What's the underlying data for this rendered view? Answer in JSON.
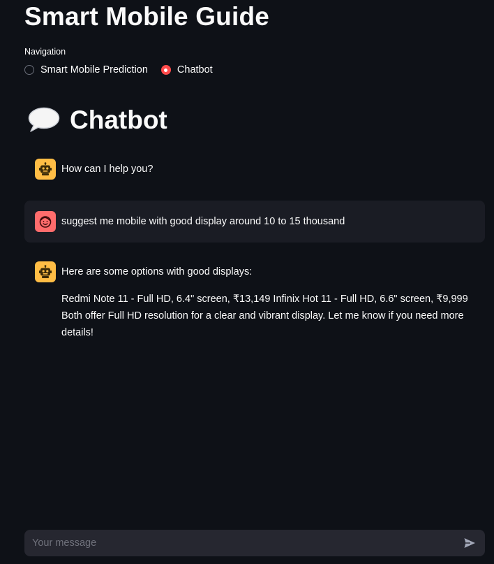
{
  "page": {
    "title": "Smart Mobile Guide"
  },
  "navigation": {
    "label": "Navigation",
    "options": [
      {
        "label": "Smart Mobile Prediction",
        "selected": false
      },
      {
        "label": "Chatbot",
        "selected": true
      }
    ]
  },
  "chat": {
    "header_icon": "speech-bubble-icon",
    "title": "Chatbot",
    "messages": [
      {
        "role": "assistant",
        "avatar_icon": "robot-icon",
        "paragraphs": [
          "How can I help you?"
        ]
      },
      {
        "role": "user",
        "avatar_icon": "smiley-face-icon",
        "paragraphs": [
          "suggest me mobile with good display around 10 to 15 thousand"
        ]
      },
      {
        "role": "assistant",
        "avatar_icon": "robot-icon",
        "paragraphs": [
          "Here are some options with good displays:",
          "Redmi Note 11 - Full HD, 6.4\" screen, ₹13,149 Infinix Hot 11 - Full HD, 6.6\" screen, ₹9,999 Both offer Full HD resolution for a clear and vibrant display. Let me know if you need more details!"
        ]
      }
    ],
    "input": {
      "placeholder": "Your message",
      "value": "",
      "send_icon": "send-arrow-icon"
    }
  },
  "colors": {
    "background": "#0e1117",
    "accent": "#ff4b4b",
    "bot_avatar": "#ffbd45",
    "user_avatar": "#ff6c6c",
    "user_message_bg": "#1a1c24",
    "input_bg": "#262730"
  }
}
